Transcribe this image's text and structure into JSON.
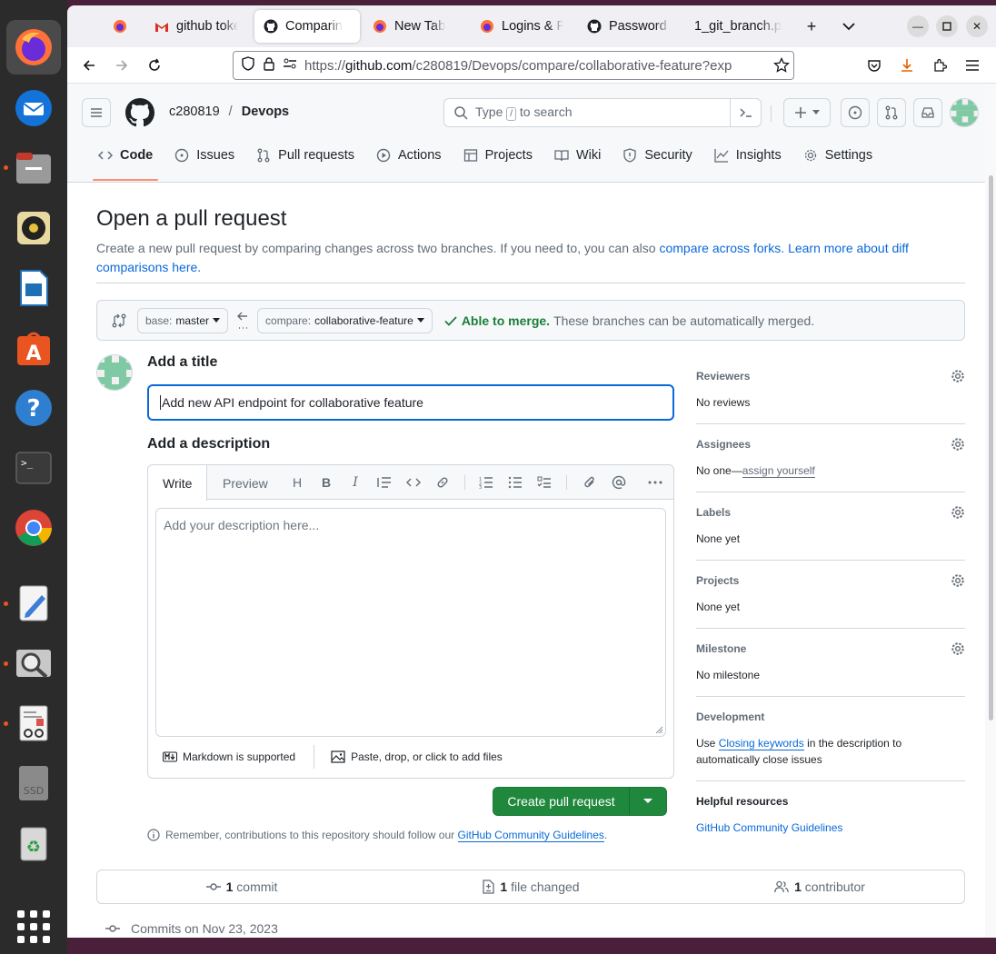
{
  "browser": {
    "tabs": [
      {
        "label": "",
        "icon": "firefox-icon"
      },
      {
        "label": "github toke",
        "icon": "gmail-icon"
      },
      {
        "label": "Comparin",
        "icon": "github-icon",
        "selected": true
      },
      {
        "label": "New Tab",
        "icon": "firefox-icon"
      },
      {
        "label": "Logins & Pa",
        "icon": "firefox-icon"
      },
      {
        "label": "Password re",
        "icon": "github-icon"
      },
      {
        "label": "1_git_branch.p",
        "icon": "none"
      }
    ],
    "url": {
      "proto": "https://",
      "host": "github.com",
      "path": "/c280819/Devops/compare/collaborative-feature?exp"
    }
  },
  "github": {
    "owner": "c280819",
    "sep": "/",
    "repo": "Devops",
    "search_prefix": "Type",
    "search_kbd": "/",
    "search_suffix": "to search",
    "nav": [
      {
        "label": "Code",
        "icon": "code-icon",
        "selected": true
      },
      {
        "label": "Issues",
        "icon": "issue-icon"
      },
      {
        "label": "Pull requests",
        "icon": "pull-request-icon"
      },
      {
        "label": "Actions",
        "icon": "play-icon"
      },
      {
        "label": "Projects",
        "icon": "table-icon"
      },
      {
        "label": "Wiki",
        "icon": "book-icon"
      },
      {
        "label": "Security",
        "icon": "shield-icon"
      },
      {
        "label": "Insights",
        "icon": "graph-icon"
      },
      {
        "label": "Settings",
        "icon": "gear-icon"
      }
    ]
  },
  "pr": {
    "heading": "Open a pull request",
    "subtitle_text": "Create a new pull request by comparing changes across two branches. If you need to, you can also ",
    "subtitle_link1": "compare across forks.",
    "subtitle_link2": "Learn more about diff comparisons here.",
    "base_prefix": "base:",
    "base_branch": "master",
    "compare_prefix": "compare:",
    "compare_branch": "collaborative-feature",
    "merge_status": "Able to merge.",
    "merge_message": "These branches can be automatically merged.",
    "title_label": "Add a title",
    "title_value": "Add new API endpoint for collaborative feature",
    "desc_label": "Add a description",
    "tab_write": "Write",
    "tab_preview": "Preview",
    "desc_placeholder": "Add your description here...",
    "markdown_note": "Markdown is supported",
    "attach_note": "Paste, drop, or click to add files",
    "create_button": "Create pull request",
    "reminder_text": "Remember, contributions to this repository should follow our",
    "reminder_link": "GitHub Community Guidelines",
    "reminder_end": "."
  },
  "sidebar": {
    "reviewers": {
      "title": "Reviewers",
      "value": "No reviews"
    },
    "assignees": {
      "title": "Assignees",
      "value": "No one—",
      "link": "assign yourself"
    },
    "labels": {
      "title": "Labels",
      "value": "None yet"
    },
    "projects": {
      "title": "Projects",
      "value": "None yet"
    },
    "milestone": {
      "title": "Milestone",
      "value": "No milestone"
    },
    "development": {
      "title": "Development",
      "prefix": "Use ",
      "link": "Closing keywords",
      "suffix": " in the description to automatically close issues"
    },
    "resources": {
      "title": "Helpful resources",
      "link": "GitHub Community Guidelines"
    }
  },
  "stats": {
    "commits_count": "1",
    "commits_label": "commit",
    "files_count": "1",
    "files_label": "file changed",
    "contributors_count": "1",
    "contributors_label": "contributor"
  },
  "commits_on": "Commits on Nov 23, 2023",
  "colors": {
    "accent_blue": "#0969da",
    "primary_green": "#1f883d",
    "merge_green": "#1a7f37",
    "dock_bg": "#2b2b2b"
  }
}
